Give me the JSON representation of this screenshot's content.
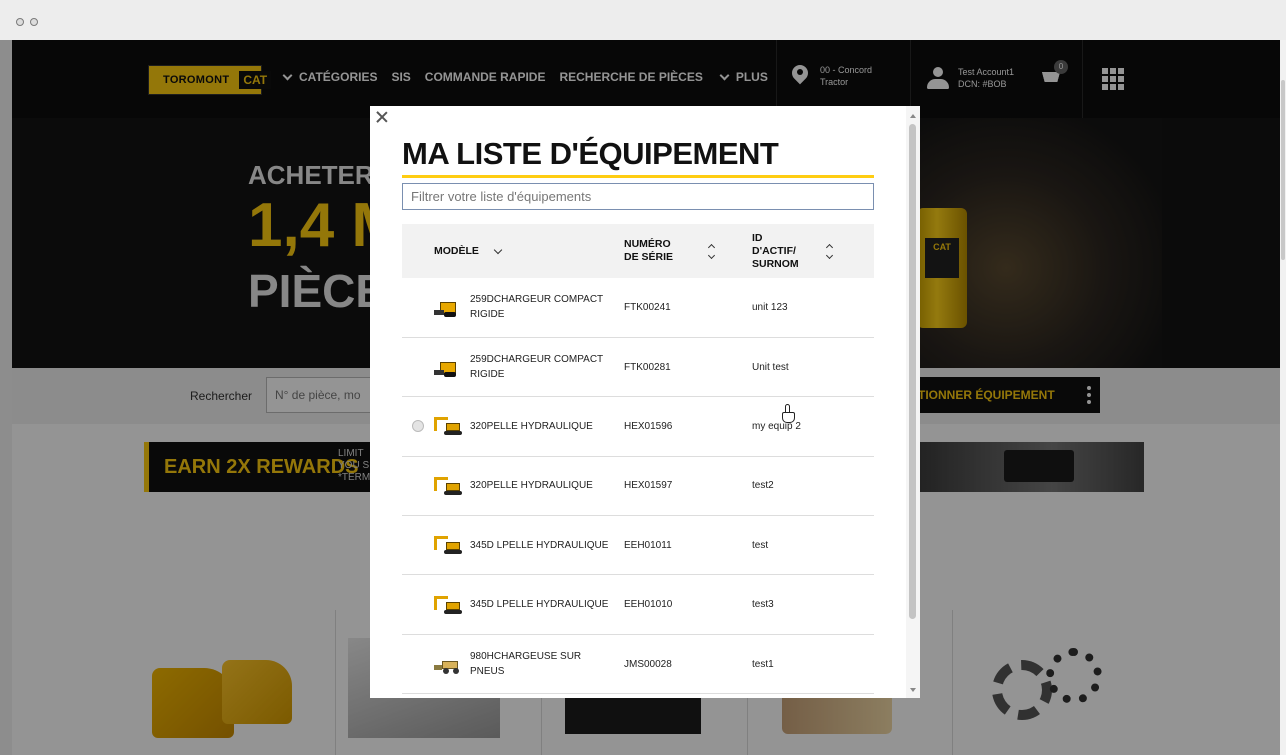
{
  "header": {
    "logo_text": "TOROMONT",
    "logo_cat": "CAT",
    "nav": [
      "CATÉGORIES",
      "SIS",
      "COMMANDE RAPIDE",
      "RECHERCHE DE PIÈCES",
      "PLUS"
    ],
    "location_line1": "00 - Concord",
    "location_line2": "Tractor",
    "account_line1": "Test Account1",
    "account_line2": "DCN: #BOB",
    "cart_count": "0"
  },
  "hero": {
    "line1": "ACHETER P",
    "line2": "1,4 M",
    "line3": "PIÈCE"
  },
  "search": {
    "label": "Rechercher",
    "placeholder": "N° de pièce, mo",
    "select_button": "TIONNER ÉQUIPEMENT"
  },
  "promo": {
    "earn": "EARN 2X REWARDS",
    "fine1": "LIMIT",
    "fine2": "YOU S",
    "fine3": "*TERM"
  },
  "modal": {
    "title": "MA LISTE D'ÉQUIPEMENT",
    "filter_placeholder": "Filtrer votre liste d'équipements",
    "columns": {
      "model": "MODÈLE",
      "serial_1": "NUMÉRO",
      "serial_2": "DE SÉRIE",
      "asset_1": "ID",
      "asset_2": "D'ACTIF/",
      "asset_3": "SURNOM"
    },
    "rows": [
      {
        "icon": "compact-track-loader-icon",
        "model_1": "259DCHARGEUR COMPACT",
        "model_2": "RIGIDE",
        "serial": "FTK00241",
        "asset": "unit 123"
      },
      {
        "icon": "compact-track-loader-icon",
        "model_1": "259DCHARGEUR COMPACT",
        "model_2": "RIGIDE",
        "serial": "FTK00281",
        "asset": "Unit test"
      },
      {
        "icon": "excavator-icon",
        "model_1": "320PELLE HYDRAULIQUE",
        "model_2": "",
        "serial": "HEX01596",
        "asset": "my equip 2"
      },
      {
        "icon": "excavator-icon",
        "model_1": "320PELLE HYDRAULIQUE",
        "model_2": "",
        "serial": "HEX01597",
        "asset": "test2"
      },
      {
        "icon": "excavator-icon",
        "model_1": "345D LPELLE HYDRAULIQUE",
        "model_2": "",
        "serial": "EEH01011",
        "asset": "test"
      },
      {
        "icon": "excavator-icon",
        "model_1": "345D LPELLE HYDRAULIQUE",
        "model_2": "",
        "serial": "EEH01010",
        "asset": "test3"
      },
      {
        "icon": "wheel-loader-icon",
        "model_1": "980HCHARGEUSE SUR PNEUS",
        "model_2": "",
        "serial": "JMS00028",
        "asset": "test1"
      }
    ]
  },
  "colors": {
    "cat_yellow": "#ffcd11",
    "header_black": "#0d0d0d"
  }
}
